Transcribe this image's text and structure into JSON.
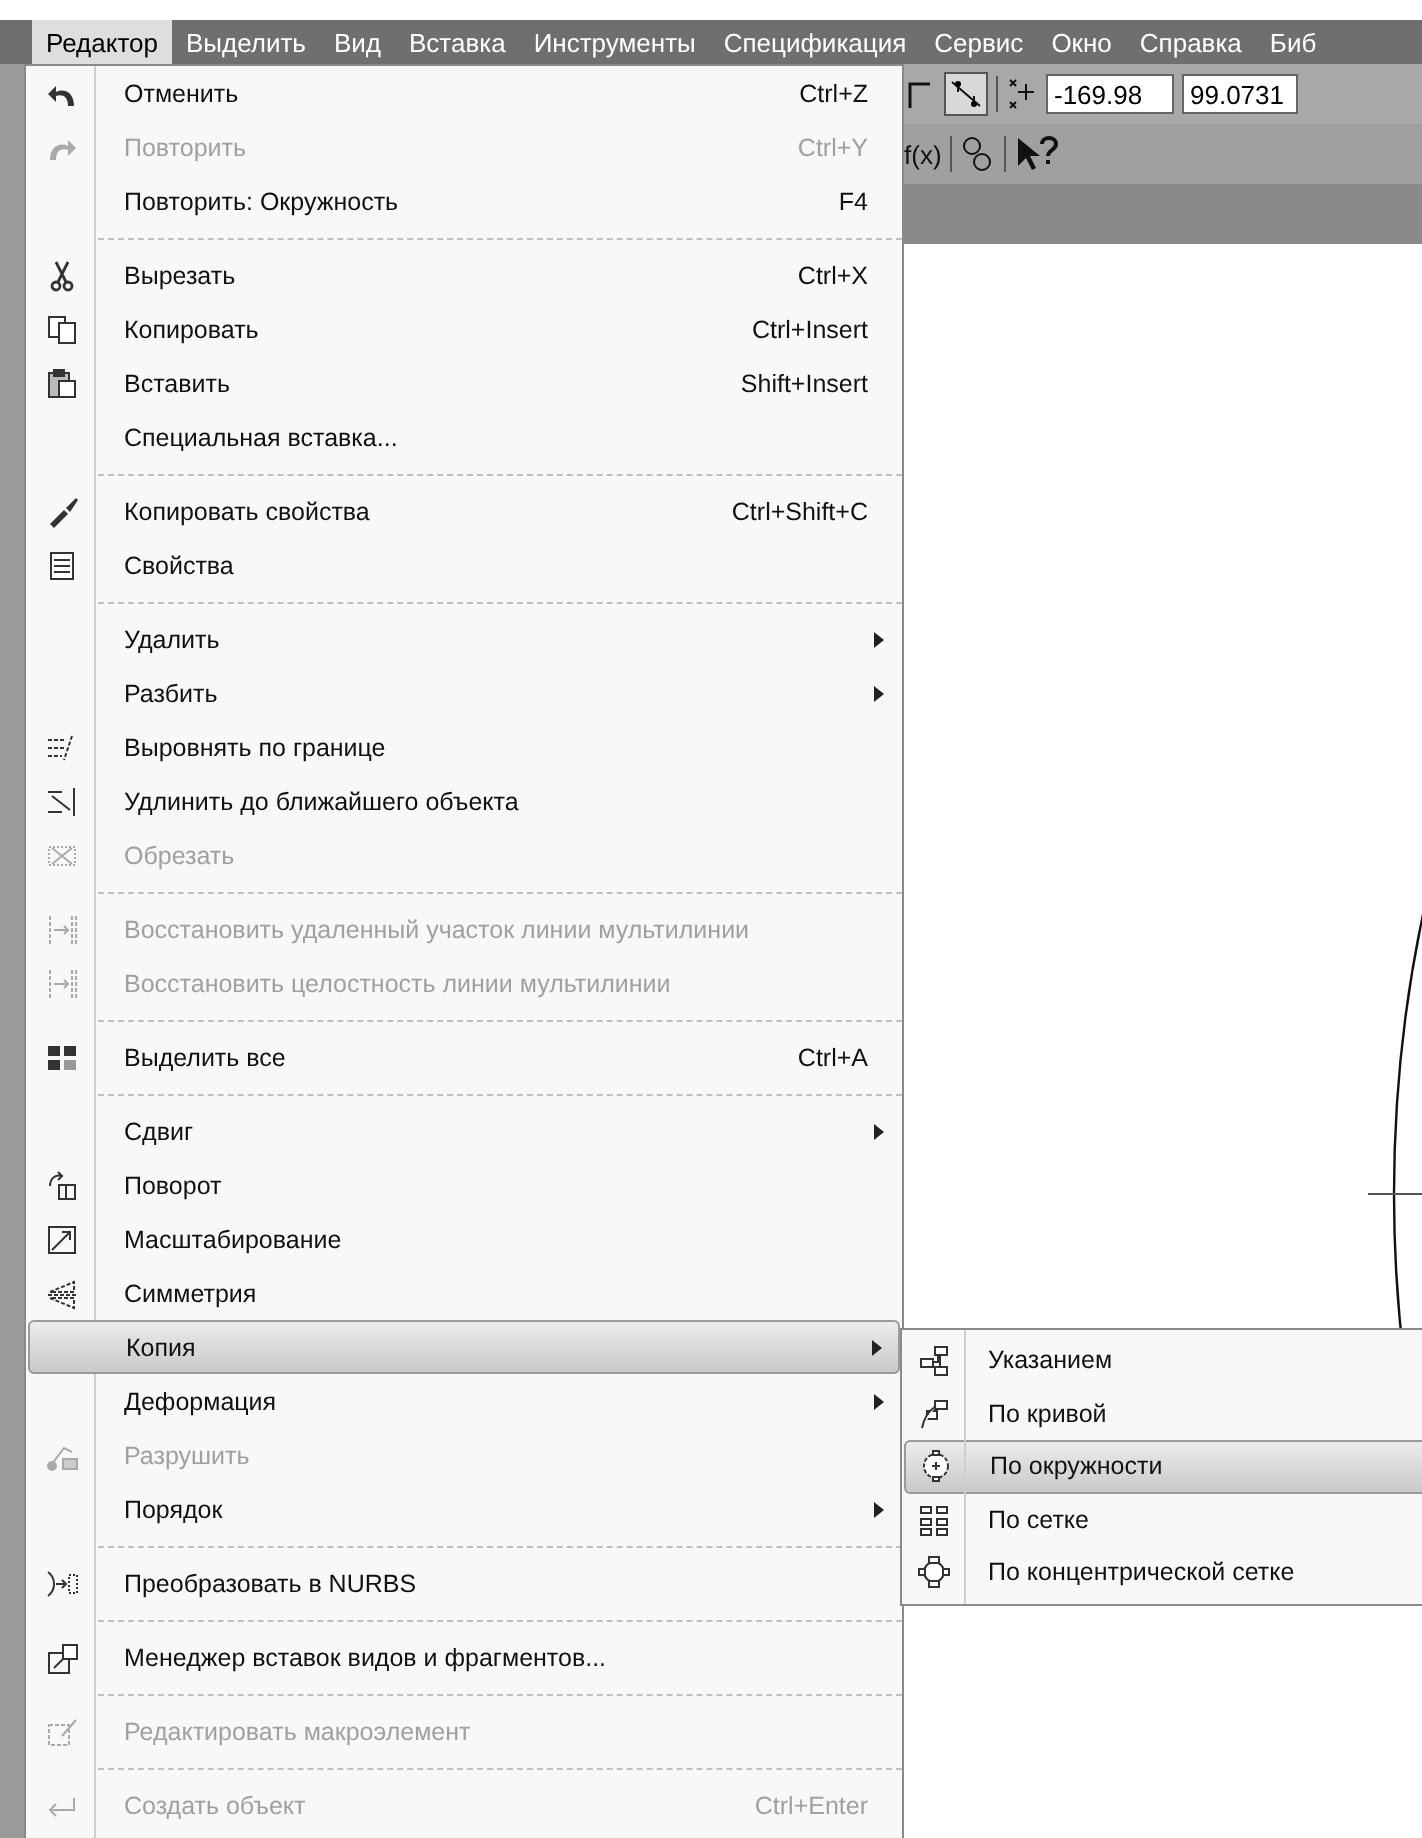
{
  "menubar": [
    {
      "label": "Редактор",
      "selected": true
    },
    {
      "label": "Выделить",
      "selected": false
    },
    {
      "label": "Вид",
      "selected": false
    },
    {
      "label": "Вставка",
      "selected": false
    },
    {
      "label": "Инструменты",
      "selected": false
    },
    {
      "label": "Спецификация",
      "selected": false
    },
    {
      "label": "Сервис",
      "selected": false
    },
    {
      "label": "Окно",
      "selected": false
    },
    {
      "label": "Справка",
      "selected": false
    },
    {
      "label": "Биб",
      "selected": false
    }
  ],
  "toolbar": {
    "x_field": "-169.98",
    "y_field": "99.0731",
    "function_label": "f(x)"
  },
  "menu": {
    "groups": [
      [
        {
          "label": "Отменить",
          "shortcut": "Ctrl+Z",
          "disabled": false,
          "submenu": false,
          "selected": false
        },
        {
          "label": "Повторить",
          "shortcut": "Ctrl+Y",
          "disabled": true,
          "submenu": false,
          "selected": false
        },
        {
          "label": "Повторить: Окружность",
          "shortcut": "F4",
          "disabled": false,
          "submenu": false,
          "selected": false
        }
      ],
      [
        {
          "label": "Вырезать",
          "shortcut": "Ctrl+X",
          "disabled": false,
          "submenu": false,
          "selected": false
        },
        {
          "label": "Копировать",
          "shortcut": "Ctrl+Insert",
          "disabled": false,
          "submenu": false,
          "selected": false
        },
        {
          "label": "Вставить",
          "shortcut": "Shift+Insert",
          "disabled": false,
          "submenu": false,
          "selected": false
        },
        {
          "label": "Специальная вставка...",
          "disabled": false,
          "submenu": false,
          "selected": false
        }
      ],
      [
        {
          "label": "Копировать свойства",
          "shortcut": "Ctrl+Shift+C",
          "disabled": false,
          "submenu": false,
          "selected": false
        },
        {
          "label": "Свойства",
          "disabled": false,
          "submenu": false,
          "selected": false
        }
      ],
      [
        {
          "label": "Удалить",
          "disabled": false,
          "submenu": true,
          "selected": false
        },
        {
          "label": "Разбить",
          "disabled": false,
          "submenu": true,
          "selected": false
        },
        {
          "label": "Выровнять по границе",
          "disabled": false,
          "submenu": false,
          "selected": false
        },
        {
          "label": "Удлинить до ближайшего объекта",
          "disabled": false,
          "submenu": false,
          "selected": false
        },
        {
          "label": "Обрезать",
          "disabled": true,
          "submenu": false,
          "selected": false
        }
      ],
      [
        {
          "label": "Восстановить удаленный участок линии мультилинии",
          "disabled": true,
          "submenu": false,
          "selected": false
        },
        {
          "label": "Восстановить целостность линии мультилинии",
          "disabled": true,
          "submenu": false,
          "selected": false
        }
      ],
      [
        {
          "label": "Выделить все",
          "shortcut": "Ctrl+A",
          "disabled": false,
          "submenu": false,
          "selected": false
        }
      ],
      [
        {
          "label": "Сдвиг",
          "disabled": false,
          "submenu": true,
          "selected": false
        },
        {
          "label": "Поворот",
          "disabled": false,
          "submenu": false,
          "selected": false
        },
        {
          "label": "Масштабирование",
          "disabled": false,
          "submenu": false,
          "selected": false
        },
        {
          "label": "Симметрия",
          "disabled": false,
          "submenu": false,
          "selected": false
        },
        {
          "label": "Копия",
          "disabled": false,
          "submenu": true,
          "selected": true
        },
        {
          "label": "Деформация",
          "disabled": false,
          "submenu": true,
          "selected": false
        },
        {
          "label": "Разрушить",
          "disabled": true,
          "submenu": false,
          "selected": false
        },
        {
          "label": "Порядок",
          "disabled": false,
          "submenu": true,
          "selected": false
        }
      ],
      [
        {
          "label": "Преобразовать в NURBS",
          "disabled": false,
          "submenu": false,
          "selected": false
        }
      ],
      [
        {
          "label": "Менеджер вставок видов и фрагментов...",
          "disabled": false,
          "submenu": false,
          "selected": false
        }
      ],
      [
        {
          "label": "Редактировать макроэлемент",
          "disabled": true,
          "submenu": false,
          "selected": false
        }
      ],
      [
        {
          "label": "Создать объект",
          "shortcut": "Ctrl+Enter",
          "disabled": true,
          "submenu": false,
          "selected": false
        }
      ]
    ]
  },
  "submenu": [
    {
      "label": "Указанием",
      "selected": false
    },
    {
      "label": "По кривой",
      "selected": false
    },
    {
      "label": "По окружности",
      "selected": true
    },
    {
      "label": "По сетке",
      "selected": false
    },
    {
      "label": "По концентрической сетке",
      "selected": false
    }
  ]
}
